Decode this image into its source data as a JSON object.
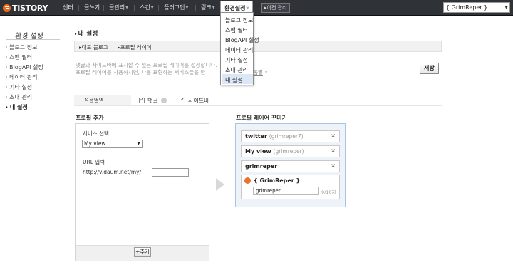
{
  "topbar": {
    "logo_text": "TISTORY",
    "nav": [
      "센터",
      "글쓰기",
      "글관리",
      "스킨",
      "플러그인",
      "링크",
      "환경설정"
    ],
    "old_admin_label": "▸이전 관리",
    "blog_select_value": "{ GrimReper }"
  },
  "dropdown": {
    "items": [
      "블로그 정보",
      "스팸 필터",
      "BlogAPI 설정",
      "데이터 관리",
      "기타 설정",
      "초대 관리",
      "내 설정"
    ]
  },
  "sidebar": {
    "title": "환경 설정",
    "items": [
      "· 블로그 정보",
      "· 스팸 필터",
      "· BlogAPI 설정",
      "· 데이터 관리",
      "· 기타 설정",
      "· 초대 관리",
      "· 내 설정"
    ]
  },
  "main": {
    "title": "내 설정",
    "breadcrumb": [
      "▸대표 블로그",
      "▸프로필 레이어"
    ],
    "desc_line1": "댓글과 사이드바에 표시할 수 있는 프로필 레이어를 설정합니다.",
    "desc_line2": "프로필 레이어를 사용하시면, 나를 표현하는 서비스들을 한",
    "help_link": "도움말",
    "save_label": "저장",
    "apply_label": "적용영역",
    "opt_comment": "댓글",
    "opt_sidebar": "사이드바"
  },
  "add_panel": {
    "title": "프로필 추가",
    "service_label": "서비스 선택",
    "service_value": "My view",
    "url_label": "URL 입력",
    "url_prefix": "http://v.daum.net/my/",
    "add_button": "+추가"
  },
  "deco_panel": {
    "title": "프로필 레이어 꾸미기",
    "profiles": [
      {
        "name": "twitter",
        "id": "(grimreper7)"
      },
      {
        "name": "My view",
        "id": "(grimreper)"
      },
      {
        "name": "grimreper",
        "id": ""
      }
    ],
    "close_glyph": "×",
    "blog_title": "{ GrimReper }",
    "blog_input": "grimreper",
    "blog_count": "9/10자"
  },
  "colors": {
    "topbar_bg": "#2f3237",
    "accent_orange": "#e8732a",
    "panel_border_blue": "#a9c3e2"
  }
}
